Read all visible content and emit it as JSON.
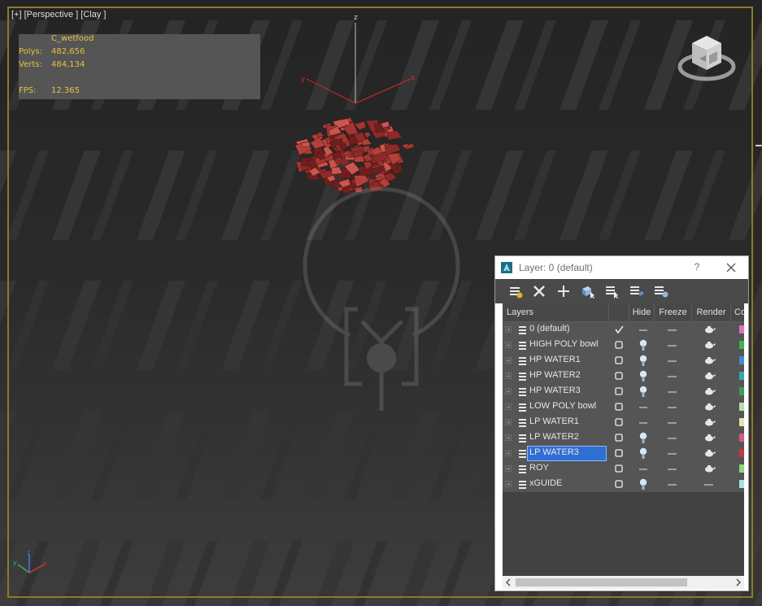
{
  "viewport": {
    "label": "[+] [Perspective ] [Clay ]",
    "object_name": "C_wetfood",
    "stats": [
      {
        "key": "Polys:",
        "value": "482,656"
      },
      {
        "key": "Verts:",
        "value": "484,134"
      }
    ],
    "fps": {
      "key": "FPS:",
      "value": "12.365"
    },
    "gizmo_axes": {
      "z": "z",
      "x": "x",
      "y": "y"
    },
    "corner_axes": {
      "z": "z",
      "x": "x",
      "y": "y"
    }
  },
  "layer_dialog": {
    "title": "Layer: 0 (default)",
    "help_label": "?",
    "toolbar_icons": [
      "create-layer-icon",
      "delete-layer-icon",
      "add-to-layer-icon",
      "select-objects-icon",
      "select-layer-icon",
      "highlight-layer-icon",
      "hide-unhide-all-icon"
    ],
    "columns": {
      "layers": "Layers",
      "hide": "Hide",
      "freeze": "Freeze",
      "render": "Render",
      "color": "Co"
    },
    "layers": [
      {
        "name": "0 (default)",
        "current": true,
        "hidden_visible": false,
        "color": "#e36fbf",
        "selected": false
      },
      {
        "name": "HIGH POLY bowl",
        "current": false,
        "hidden_visible": true,
        "color": "#3fb44a",
        "selected": false
      },
      {
        "name": "HP WATER1",
        "current": false,
        "hidden_visible": true,
        "color": "#3b8fd1",
        "selected": false
      },
      {
        "name": "HP WATER2",
        "current": false,
        "hidden_visible": true,
        "color": "#39a6b8",
        "selected": false
      },
      {
        "name": "HP WATER3",
        "current": false,
        "hidden_visible": true,
        "color": "#3a9e5a",
        "selected": false
      },
      {
        "name": "LOW POLY bowl",
        "current": false,
        "hidden_visible": false,
        "color": "#b4e0a8",
        "selected": false
      },
      {
        "name": "LP WATER1",
        "current": false,
        "hidden_visible": false,
        "color": "#f1dfb0",
        "selected": false
      },
      {
        "name": "LP WATER2",
        "current": false,
        "hidden_visible": true,
        "color": "#d35a86",
        "selected": false
      },
      {
        "name": "LP WATER3",
        "current": false,
        "hidden_visible": true,
        "color": "#c23a3a",
        "selected": true
      },
      {
        "name": "ROY",
        "current": false,
        "hidden_visible": false,
        "color": "#8fd67a",
        "selected": false
      },
      {
        "name": "xGUIDE",
        "current": false,
        "hidden_visible": true,
        "color": "#a8e0e8",
        "selected": false
      }
    ]
  }
}
